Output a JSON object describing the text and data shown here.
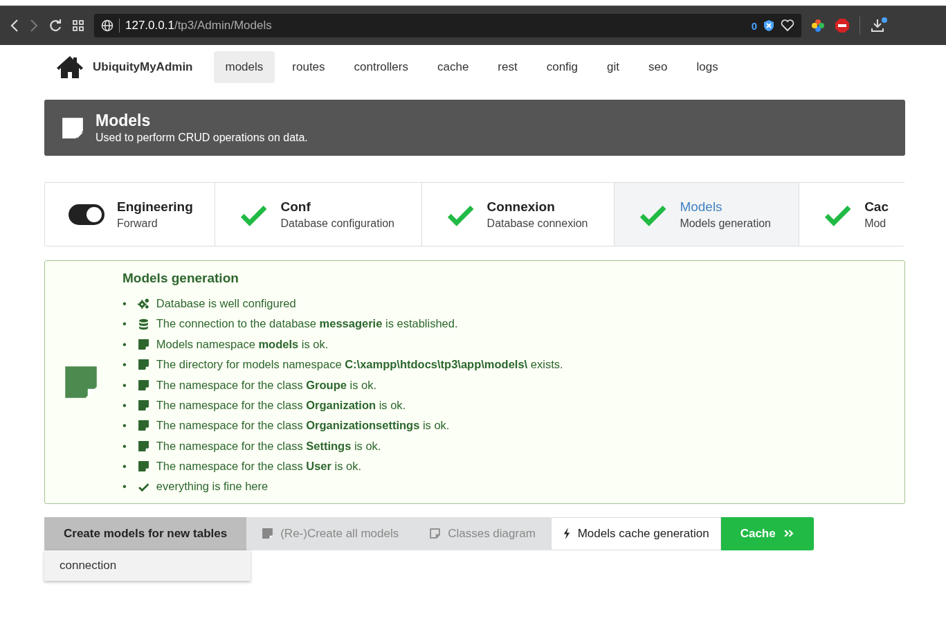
{
  "browser": {
    "url": "**127.0.0.1**/tp3/Admin/Models",
    "shield_count": "0"
  },
  "nav": {
    "brand": "UbiquityMyAdmin",
    "items": [
      {
        "label": "models",
        "selected": true
      },
      {
        "label": "routes",
        "selected": false
      },
      {
        "label": "controllers",
        "selected": false
      },
      {
        "label": "cache",
        "selected": false
      },
      {
        "label": "rest",
        "selected": false
      },
      {
        "label": "config",
        "selected": false
      },
      {
        "label": "git",
        "selected": false
      },
      {
        "label": "seo",
        "selected": false
      },
      {
        "label": "logs",
        "selected": false
      }
    ]
  },
  "header": {
    "title": "Models",
    "subtitle": "Used to perform CRUD operations on data."
  },
  "steps": [
    {
      "kind": "toggle",
      "on": true,
      "title": "Engineering",
      "description": "Forward",
      "selected": false
    },
    {
      "kind": "check",
      "title": "Conf",
      "description": "Database configuration",
      "selected": false
    },
    {
      "kind": "check",
      "title": "Connexion",
      "description": "Database connexion",
      "selected": false
    },
    {
      "kind": "check",
      "title": "Models",
      "description": "Models generation",
      "selected": true
    },
    {
      "kind": "check",
      "title": "Cac",
      "description": "Mod",
      "selected": false
    }
  ],
  "message": {
    "title": "Models generation",
    "items": [
      {
        "kind": "cogs",
        "bullet": "•",
        "text": "Database is well configured"
      },
      {
        "kind": "database",
        "bullet": "•",
        "text": "The connection to the database **messagerie** is established."
      },
      {
        "kind": "file",
        "bullet": "•",
        "text": "Models namespace **models** is ok."
      },
      {
        "kind": "file",
        "bullet": "•",
        "text": "The directory for models namespace **C:\\xampp\\htdocs\\tp3\\app\\models\\** exists."
      },
      {
        "kind": "file",
        "bullet": "•",
        "text": "The namespace for the class **Groupe** is ok."
      },
      {
        "kind": "file",
        "bullet": "•",
        "text": "The namespace for the class **Organization** is ok."
      },
      {
        "kind": "file",
        "bullet": "•",
        "text": "The namespace for the class **Organizationsettings** is ok."
      },
      {
        "kind": "file",
        "bullet": "•",
        "text": "The namespace for the class **Settings** is ok."
      },
      {
        "kind": "file",
        "bullet": "•",
        "text": "The namespace for the class **User** is ok."
      },
      {
        "kind": "check",
        "bullet": "•",
        "text": "everything is fine here"
      }
    ]
  },
  "actions": [
    {
      "kind": "dropdown",
      "label": "Create models for new tables",
      "disabled": false,
      "expanded": true,
      "menu": [
        "connection"
      ]
    },
    {
      "kind": "plain-file",
      "label": "(Re-)Create all models",
      "disabled": true
    },
    {
      "kind": "plain-outline",
      "label": "Classes diagram",
      "disabled": true
    },
    {
      "kind": "basic-bolt",
      "label": "Models cache generation",
      "disabled": false
    },
    {
      "kind": "primary",
      "label": "Cache",
      "disabled": false
    }
  ]
}
